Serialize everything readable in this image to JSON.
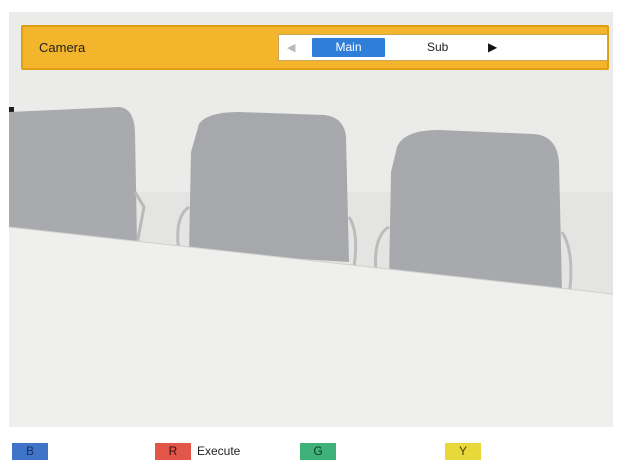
{
  "camera_panel": {
    "title": "Camera",
    "options": [
      "Main",
      "Sub"
    ],
    "selected": "Main",
    "arrow_left": "◀",
    "arrow_right": "▶"
  },
  "function_keys": [
    {
      "key": "B",
      "label": "",
      "color": "#3f74c8"
    },
    {
      "key": "R",
      "label": "Execute",
      "color": "#e2574a"
    },
    {
      "key": "G",
      "label": "",
      "color": "#3fb27a"
    },
    {
      "key": "Y",
      "label": "",
      "color": "#e8d83a"
    }
  ],
  "colors": {
    "panel_bar": "#f3b52b",
    "selected_option": "#2f7fd8"
  }
}
